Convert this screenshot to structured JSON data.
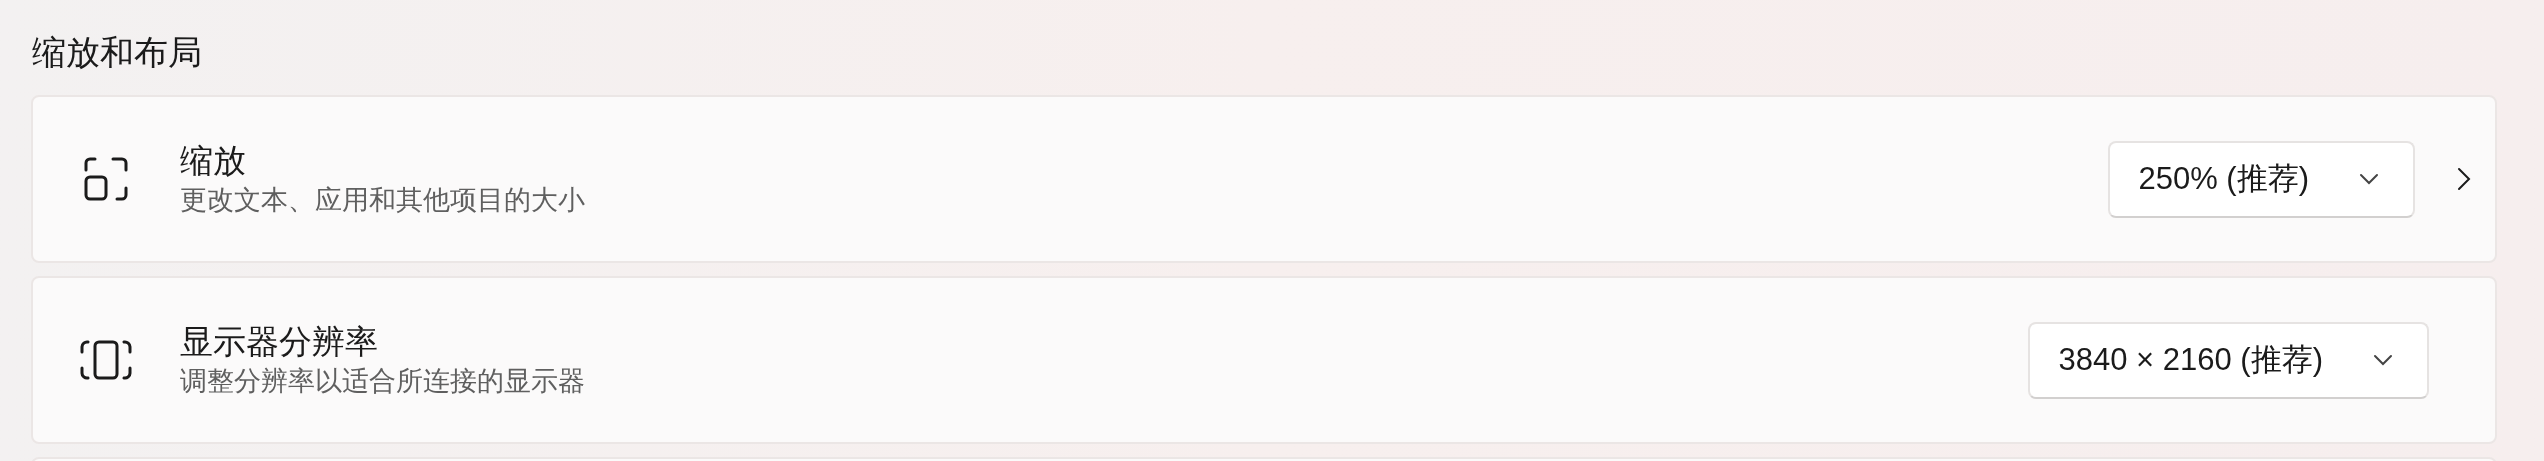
{
  "section": {
    "title": "缩放和布局"
  },
  "rows": [
    {
      "kind": "scale",
      "title": "缩放",
      "description": "更改文本、应用和其他项目的大小",
      "dropdown": {
        "value": "250% (推荐)"
      },
      "navigable": true
    },
    {
      "kind": "resolution",
      "title": "显示器分辨率",
      "description": "调整分辨率以适合所连接的显示器",
      "dropdown": {
        "value": "3840 × 2160 (推荐)"
      },
      "navigable": false
    }
  ]
}
